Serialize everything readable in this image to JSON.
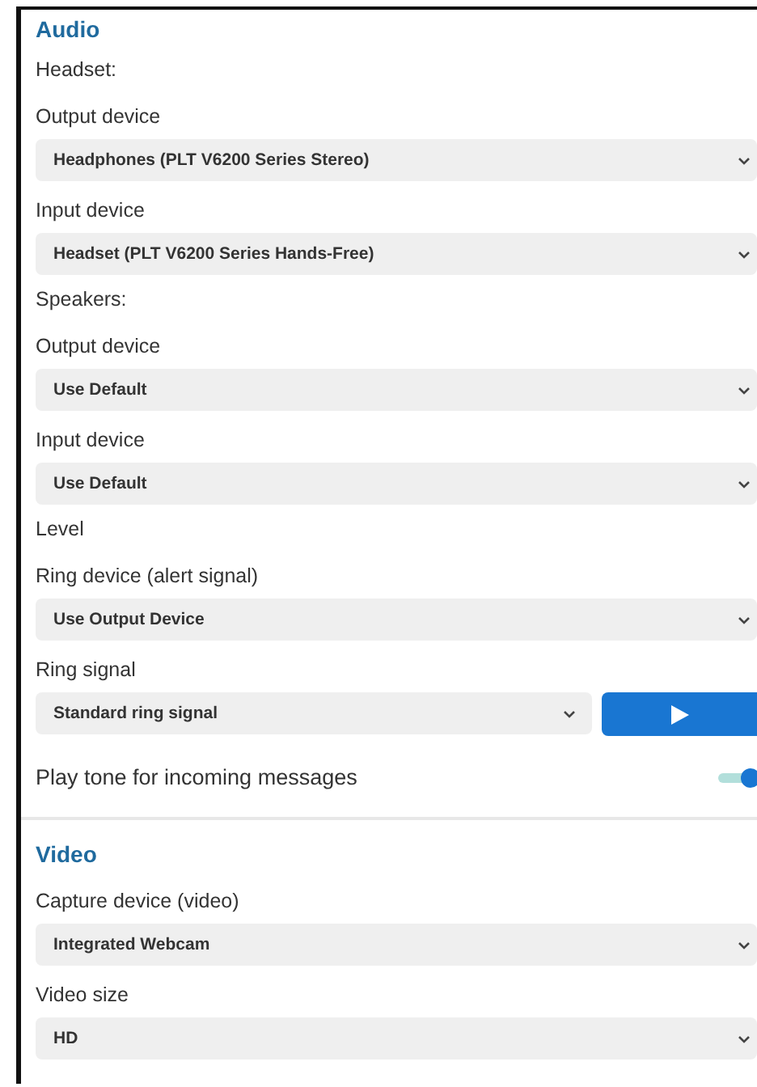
{
  "sections": [
    {
      "title": "Audio",
      "rows": [
        {
          "kind": "group",
          "text": "Headset:"
        },
        {
          "kind": "select",
          "label": "Output device",
          "value": "Headphones (PLT V6200 Series Stereo)"
        },
        {
          "kind": "select",
          "label": "Input device",
          "value": "Headset (PLT V6200 Series Hands-Free)"
        },
        {
          "kind": "group",
          "text": "Speakers:"
        },
        {
          "kind": "select",
          "label": "Output device",
          "value": "Use Default"
        },
        {
          "kind": "select",
          "label": "Input device",
          "value": "Use Default"
        },
        {
          "kind": "group",
          "text": "Level"
        },
        {
          "kind": "select",
          "label": "Ring device (alert signal)",
          "value": "Use Output Device"
        },
        {
          "kind": "select_play",
          "label": "Ring signal",
          "value": "Standard ring signal"
        },
        {
          "kind": "toggle",
          "label": "Play tone for incoming messages",
          "on": true
        }
      ]
    },
    {
      "title": "Video",
      "rows": [
        {
          "kind": "select",
          "label": "Capture device (video)",
          "value": "Integrated Webcam"
        },
        {
          "kind": "select",
          "label": "Video size",
          "value": "HD"
        }
      ]
    }
  ]
}
